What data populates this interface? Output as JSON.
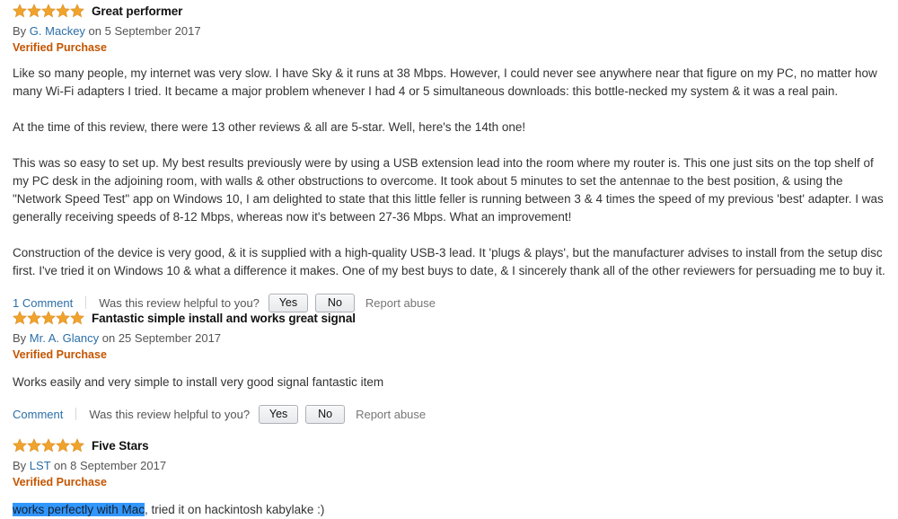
{
  "page": {
    "context": "amazon-product-reviews-list"
  },
  "icons": {
    "star": "star-icon",
    "star_count": 5
  },
  "colors": {
    "star_fill": "#f0a32c",
    "star_stroke": "#d98b1e",
    "verified_text": "#c45500",
    "link": "#2b6fa8",
    "body_text": "#333333",
    "muted_text": "#767676",
    "selection_bg": "#3297fd",
    "button_border": "#adb1b8"
  },
  "reviews": [
    {
      "rating": 5,
      "rating_label": "5.0 out of 5 stars",
      "title": "Great performer",
      "by_prefix": "By",
      "author": "G. Mackey",
      "date_prefix": "on",
      "date": "5 September 2017",
      "verified": "Verified Purchase",
      "paragraphs": [
        "Like so many people, my internet was very slow. I have Sky & it runs at 38 Mbps. However, I could never see anywhere near that figure on my PC, no matter how many Wi-Fi adapters I tried. It became a major problem whenever I had 4 or 5 simultaneous downloads: this bottle-necked my system & it was a real pain.",
        "At the time of this review, there were 13 other reviews & all are 5-star. Well, here's the 14th one!",
        "This was so easy to set up. My best results previously were by using a USB extension lead into the room where my router is. This one just sits on the top shelf of my PC desk in the adjoining room, with walls & other obstructions to overcome. It took about 5 minutes to set the antennae to the best position, & using the \"Network Speed Test\" app on Windows 10, I am delighted to state that this little feller is running between 3 & 4 times the speed of my previous 'best' adapter. I was generally receiving speeds of 8-12 Mbps, whereas now it's between 27-36 Mbps. What an improvement!",
        "Construction of the device is very good, & it is supplied with a high-quality USB-3 lead. It 'plugs & plays', but the manufacturer advises to install from the setup disc first. I've tried it on Windows 10 & what a difference it makes. One of my best buys to date, & I sincerely thank all of the other reviewers for persuading me to buy it."
      ],
      "footer": {
        "comment_label": "1 Comment",
        "helpful_question": "Was this review helpful to you?",
        "yes_label": "Yes",
        "no_label": "No",
        "report_label": "Report abuse"
      }
    },
    {
      "rating": 5,
      "rating_label": "5.0 out of 5 stars",
      "title": "Fantastic simple install and works great signal",
      "by_prefix": "By",
      "author": "Mr. A. Glancy",
      "date_prefix": "on",
      "date": "25 September 2017",
      "verified": "Verified Purchase",
      "body": "Works easily and very simple to install very good signal fantastic item",
      "footer": {
        "comment_label": "Comment",
        "helpful_question": "Was this review helpful to you?",
        "yes_label": "Yes",
        "no_label": "No",
        "report_label": "Report abuse"
      }
    },
    {
      "rating": 5,
      "rating_label": "5.0 out of 5 stars",
      "title": "Five Stars",
      "by_prefix": "By",
      "author": "LST",
      "date_prefix": "on",
      "date": "8 September 2017",
      "verified": "Verified Purchase",
      "body_selected": "works perfectly with Mac",
      "body_rest": ", tried it on hackintosh kabylake :)"
    }
  ]
}
